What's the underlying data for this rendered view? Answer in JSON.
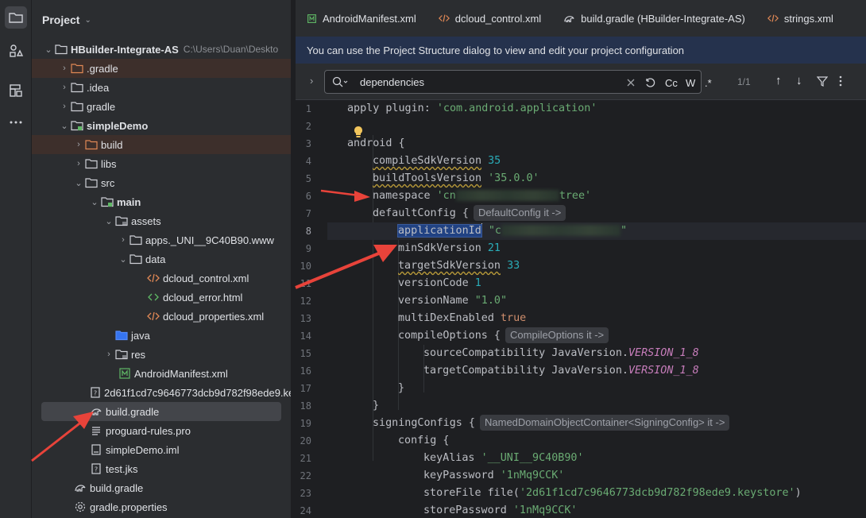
{
  "project_panel": {
    "title": "Project",
    "tree": [
      {
        "label": "HBuilder-Integrate-AS",
        "path": "C:\\Users\\Duan\\Deskto",
        "bold": true
      },
      {
        "label": ".gradle"
      },
      {
        "label": ".idea"
      },
      {
        "label": "gradle"
      },
      {
        "label": "simpleDemo",
        "bold": true
      },
      {
        "label": "build"
      },
      {
        "label": "libs"
      },
      {
        "label": "src"
      },
      {
        "label": "main",
        "bold": true
      },
      {
        "label": "assets"
      },
      {
        "label": "apps._UNI__9C40B90.www"
      },
      {
        "label": "data"
      },
      {
        "label": "dcloud_control.xml"
      },
      {
        "label": "dcloud_error.html"
      },
      {
        "label": "dcloud_properties.xml"
      },
      {
        "label": "java"
      },
      {
        "label": "res"
      },
      {
        "label": "AndroidManifest.xml"
      },
      {
        "label": "2d61f1cd7c9646773dcb9d782f98ede9.ke"
      },
      {
        "label": "build.gradle"
      },
      {
        "label": "proguard-rules.pro"
      },
      {
        "label": "simpleDemo.iml"
      },
      {
        "label": "test.jks"
      },
      {
        "label": "build.gradle"
      },
      {
        "label": "gradle.properties"
      }
    ]
  },
  "editor_tabs": [
    "AndroidManifest.xml",
    "dcloud_control.xml",
    "build.gradle (HBuilder-Integrate-AS)",
    "strings.xml"
  ],
  "banner": "You can use the Project Structure dialog to view and edit your project configuration",
  "find": {
    "query": "dependencies",
    "match_count": "1/1",
    "opt_cc": "Cc",
    "opt_w": "W",
    "opt_regex": ".*"
  },
  "line_numbers": [
    "1",
    "2",
    "3",
    "4",
    "5",
    "6",
    "7",
    "8",
    "9",
    "10",
    "11",
    "12",
    "13",
    "14",
    "15",
    "16",
    "17",
    "18",
    "19",
    "20",
    "21",
    "22",
    "23",
    "24"
  ],
  "code": {
    "apply": "apply plugin: ",
    "apply_str": "'com.android.application'",
    "android": "android {",
    "compileSdk": "compileSdkVersion",
    "compileSdk_val": "35",
    "buildTools": "buildToolsVersion",
    "buildTools_val": "'35.0.0'",
    "namespace": "namespace ",
    "namespace_pre": "'cn",
    "namespace_post": "tree'",
    "defaultConfig": "defaultConfig {",
    "defaultConfig_hint": "DefaultConfig it ->",
    "applicationId": "applicationId",
    "applicationId_pre": "\"c",
    "applicationId_post": "\"",
    "minSdk": "minSdkVersion ",
    "minSdk_val": "21",
    "targetSdk": "targetSdkVersion",
    "targetSdk_val": "33",
    "versionCode": "versionCode ",
    "versionCode_val": "1",
    "versionName": "versionName ",
    "versionName_val": "\"1.0\"",
    "multiDex": "multiDexEnabled ",
    "multiDex_val": "true",
    "compileOptions": "compileOptions {",
    "compileOptions_hint": "CompileOptions it ->",
    "sourceCompat": "sourceCompatibility JavaVersion.",
    "targetCompat": "targetCompatibility JavaVersion.",
    "version18": "VERSION_1_8",
    "close": "}",
    "signingConfigs": "signingConfigs {",
    "signingConfigs_hint": "NamedDomainObjectContainer<SigningConfig> it ->",
    "config": "config {",
    "keyAlias": "keyAlias ",
    "keyAlias_val": "'__UNI__9C40B90'",
    "keyPassword": "keyPassword ",
    "keyPassword_val": "'1nMq9CCK'",
    "storeFile": "storeFile file(",
    "storeFile_val": "'2d61f1cd7c9646773dcb9d782f98ede9.keystore'",
    "storeFile_end": ")",
    "storePassword": "storePassword ",
    "storePassword_val": "'1nMq9CCK'"
  },
  "colors": {
    "background": "#1e1f22",
    "panel": "#2b2d30",
    "banner": "#25324d",
    "keyword": "#cf8e6d",
    "string": "#6aab73",
    "number": "#2aacb8",
    "arrow": "#e8433a"
  }
}
